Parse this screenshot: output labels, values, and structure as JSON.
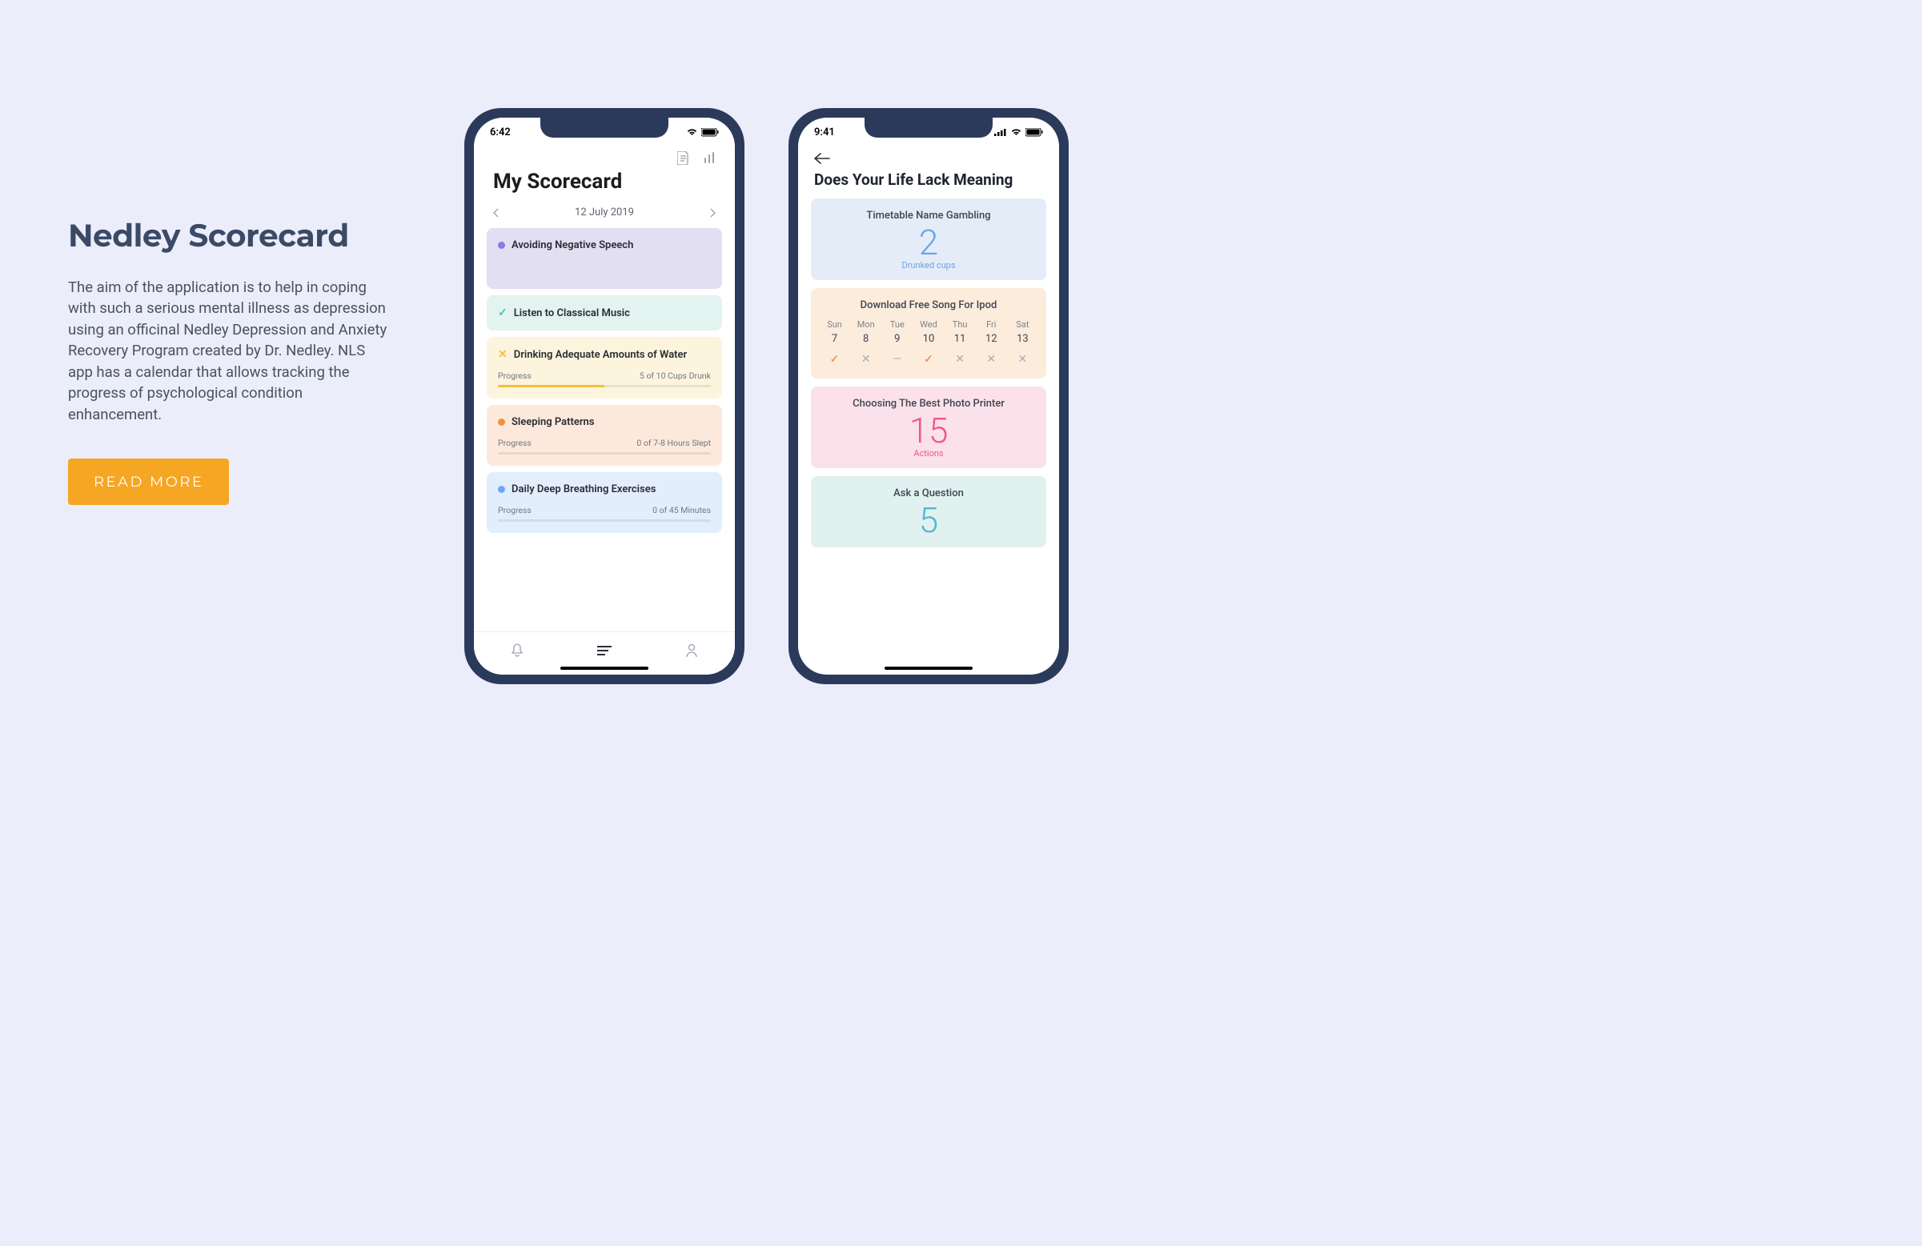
{
  "left": {
    "title": "Nedley Scorecard",
    "description": "The aim of the application is to help in coping with such a serious mental illness as depression using an officinal Nedley Depression and Anxiety Recovery Program created by Dr. Nedley. NLS app has a calendar that allows tracking the progress of psychological condition enhancement.",
    "read_more": "READ MORE"
  },
  "phone1": {
    "status_time": "6:42",
    "title": "My Scorecard",
    "date": "12 July 2019",
    "cards": [
      {
        "label": "Avoiding Negative Speech"
      },
      {
        "label": "Listen to Classical Music"
      },
      {
        "label": "Drinking Adequate Amounts of Water",
        "prog_label": "Progress",
        "prog_text": "5 of 10 Cups Drunk"
      },
      {
        "label": "Sleeping Patterns",
        "prog_label": "Progress",
        "prog_text": "0 of 7-8 Hours Slept"
      },
      {
        "label": "Daily Deep Breathing Exercises",
        "prog_label": "Progress",
        "prog_text": "0 of 45 Minutes"
      }
    ]
  },
  "phone2": {
    "status_time": "9:41",
    "title": "Does Your Life Lack Meaning",
    "block1": {
      "title": "Timetable Name Gambling",
      "value": "2",
      "sub": "Drunked cups"
    },
    "block2": {
      "title": "Download Free Song For Ipod",
      "days_lab": [
        "Sun",
        "Mon",
        "Tue",
        "Wed",
        "Thu",
        "Fri",
        "Sat"
      ],
      "days_num": [
        "7",
        "8",
        "9",
        "10",
        "11",
        "12",
        "13"
      ]
    },
    "block3": {
      "title": "Choosing The Best Photo Printer",
      "value": "15",
      "sub": "Actions"
    },
    "block4": {
      "title": "Ask a Question",
      "value": "5"
    }
  }
}
